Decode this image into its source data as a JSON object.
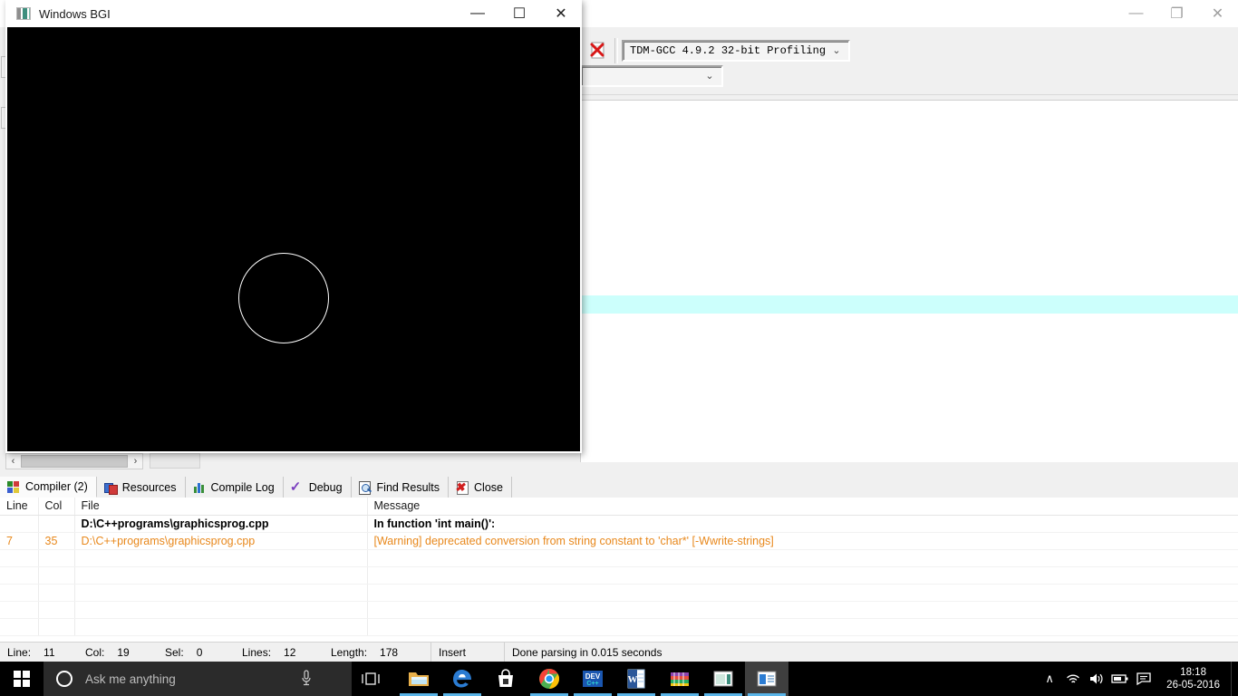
{
  "devcpp": {
    "window_buttons": [
      {
        "name": "minimize",
        "glyph": "—"
      },
      {
        "name": "restore",
        "glyph": "❐"
      },
      {
        "name": "close",
        "glyph": "✕"
      }
    ],
    "toolbar": {
      "compiler_combo_value": "TDM-GCC 4.9.2 32-bit Profiling",
      "second_combo_value": "",
      "arrow_glyph": "⌄"
    },
    "panel_tabs": [
      {
        "label": "Compiler (2)",
        "icon": "four-squares-icon",
        "active": true
      },
      {
        "label": "Resources",
        "icon": "resources-icon",
        "active": false
      },
      {
        "label": "Compile Log",
        "icon": "bar-chart-icon",
        "active": false
      },
      {
        "label": "Debug",
        "icon": "check-icon",
        "active": false
      },
      {
        "label": "Find Results",
        "icon": "magnifier-icon",
        "active": false
      },
      {
        "label": "Close",
        "icon": "close-red-x-icon",
        "active": false
      }
    ],
    "results": {
      "headers": [
        "Line",
        "Col",
        "File",
        "Message"
      ],
      "rows": [
        {
          "style": "bold",
          "line": "",
          "col": "",
          "file": "D:\\C++programs\\graphicsprog.cpp",
          "message": "In function 'int main()':"
        },
        {
          "style": "warn",
          "line": "7",
          "col": "35",
          "file": "D:\\C++programs\\graphicsprog.cpp",
          "message": "[Warning] deprecated conversion from string constant to 'char*' [-Wwrite-strings]"
        },
        {
          "style": "empty",
          "line": "",
          "col": "",
          "file": "",
          "message": ""
        },
        {
          "style": "empty",
          "line": "",
          "col": "",
          "file": "",
          "message": ""
        },
        {
          "style": "empty",
          "line": "",
          "col": "",
          "file": "",
          "message": ""
        },
        {
          "style": "empty",
          "line": "",
          "col": "",
          "file": "",
          "message": ""
        },
        {
          "style": "empty",
          "line": "",
          "col": "",
          "file": "",
          "message": ""
        }
      ]
    },
    "statusbar": {
      "line_label": "Line:",
      "line_value": "11",
      "col_label": "Col:",
      "col_value": "19",
      "sel_label": "Sel:",
      "sel_value": "0",
      "lines_label": "Lines:",
      "lines_value": "12",
      "length_label": "Length:",
      "length_value": "178",
      "mode": "Insert",
      "message": "Done parsing in 0.015 seconds"
    }
  },
  "bgi_window": {
    "title": "Windows BGI",
    "buttons": [
      {
        "name": "minimize",
        "glyph": "—"
      },
      {
        "name": "maximize",
        "glyph": "☐"
      },
      {
        "name": "close",
        "glyph": "✕"
      }
    ],
    "canvas": {
      "background_color": "#000000",
      "shape": "circle",
      "stroke_color": "#ffffff"
    },
    "scrollbar": {
      "left_arrow": "‹",
      "right_arrow": "›"
    }
  },
  "taskbar": {
    "search_placeholder": "Ask me anything",
    "apps": [
      {
        "name": "file-explorer",
        "active": true
      },
      {
        "name": "microsoft-edge",
        "active": true
      },
      {
        "name": "microsoft-store",
        "active": false
      },
      {
        "name": "google-chrome",
        "active": true
      },
      {
        "name": "dev-cpp",
        "active": true
      },
      {
        "name": "microsoft-word",
        "active": true
      },
      {
        "name": "winrar",
        "active": true
      },
      {
        "name": "windows-bgi",
        "active": true
      },
      {
        "name": "dev-cpp-window",
        "active": true
      }
    ],
    "tray": {
      "show_hidden_glyph": "∧",
      "icons": [
        "wifi-icon",
        "volume-icon",
        "battery-icon",
        "action-center-icon"
      ],
      "time": "18:18",
      "date": "26-05-2016"
    }
  }
}
